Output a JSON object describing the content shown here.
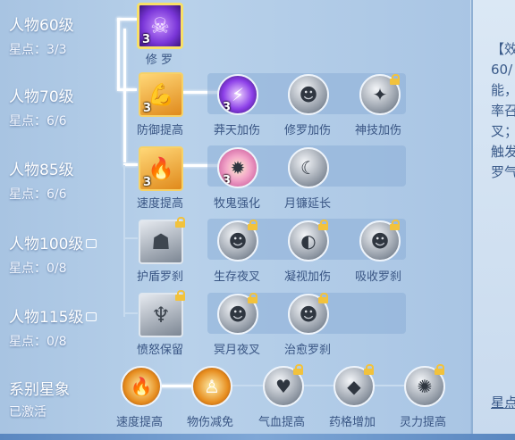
{
  "rows": [
    {
      "title": "人物60级",
      "stars": "星点：3/3",
      "locked": false
    },
    {
      "title": "人物70级",
      "stars": "星点：6/6",
      "locked": false
    },
    {
      "title": "人物85级",
      "stars": "星点：6/6",
      "locked": false
    },
    {
      "title": "人物100级",
      "stars": "星点：0/8",
      "locked": true
    },
    {
      "title": "人物115级",
      "stars": "星点：0/8",
      "locked": true
    }
  ],
  "series": {
    "title": "系别星象",
    "status": "已激活"
  },
  "nodes": {
    "r60": {
      "label": "修 罗",
      "level": "3",
      "icon": "asura-mask-icon"
    },
    "r70": [
      {
        "label": "防御提高",
        "level": "3",
        "icon": "flexed-arm-icon"
      },
      {
        "label": "莽天加伤",
        "level": "3",
        "icon": "lightning-strike-icon"
      },
      {
        "label": "修罗加伤",
        "level": "",
        "icon": "demon-face-icon"
      },
      {
        "label": "神技加伤",
        "level": "",
        "icon": "claw-slash-icon"
      }
    ],
    "r85": [
      {
        "label": "速度提高",
        "level": "3",
        "icon": "flaming-boot-icon"
      },
      {
        "label": "牧鬼强化",
        "level": "3",
        "icon": "ghost-treasure-icon"
      },
      {
        "label": "月镰延长",
        "level": "",
        "icon": "crescent-blade-icon"
      }
    ],
    "r100": [
      {
        "label": "护盾罗刹",
        "level": "",
        "icon": "shield-demon-icon"
      },
      {
        "label": "生存夜叉",
        "level": "",
        "icon": "yaksha-face-icon"
      },
      {
        "label": "凝视加伤",
        "level": "",
        "icon": "moon-eye-icon"
      },
      {
        "label": "吸收罗刹",
        "level": "",
        "icon": "rakshasa-face-icon"
      }
    ],
    "r115": [
      {
        "label": "愤怒保留",
        "level": "",
        "icon": "rage-demon-icon"
      },
      {
        "label": "冥月夜叉",
        "level": "",
        "icon": "yaksha-face-icon"
      },
      {
        "label": "治愈罗刹",
        "level": "",
        "icon": "rakshasa-face-icon"
      }
    ],
    "bottom": [
      {
        "label": "速度提高",
        "icon": "flaming-boot-icon"
      },
      {
        "label": "物伤减免",
        "icon": "golden-body-icon"
      },
      {
        "label": "气血提高",
        "icon": "heart-icon"
      },
      {
        "label": "药格增加",
        "icon": "crystal-icon"
      },
      {
        "label": "灵力提高",
        "icon": "spirit-burst-icon"
      }
    ]
  },
  "side_panel": {
    "lines": [
      "【效",
      "60/",
      "能，",
      "率召",
      "叉；",
      "触发",
      "罗气"
    ],
    "footer": "星点"
  },
  "colors": {
    "link": "#ffffff",
    "label_text": "#3a5684",
    "row_text": "#ffffff",
    "lock": "#f2c23c"
  }
}
